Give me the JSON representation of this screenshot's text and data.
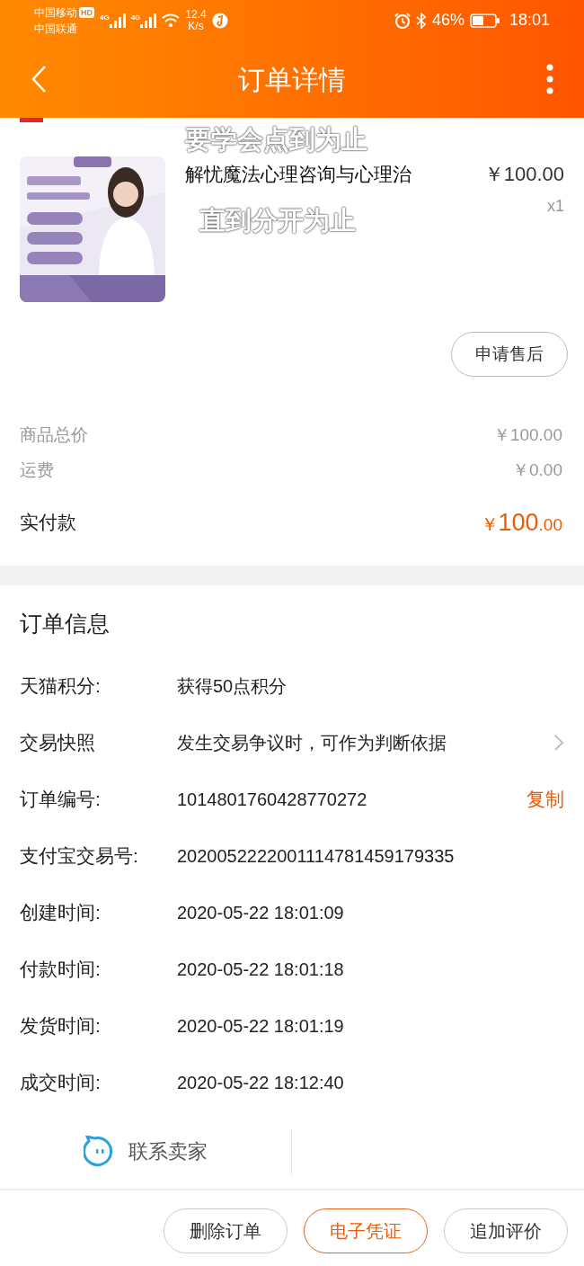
{
  "status_bar": {
    "carrier_1": "中国移动",
    "hd": "HD",
    "carrier_2": "中国联通",
    "net_1": "4G",
    "net_2": "4G",
    "speed": "12.4",
    "speed_unit": "K/s",
    "battery": "46%",
    "time": "18:01"
  },
  "header": {
    "title": "订单详情"
  },
  "product": {
    "title": "解忧魔法心理咨询与心理治",
    "price": "￥100.00",
    "quantity": "x1",
    "after_sale_button": "申请售后"
  },
  "caption": [
    "要学会点到为止",
    "直到分开为止"
  ],
  "summary": [
    {
      "label": "商品总价",
      "value": "￥100.00",
      "kind": "line"
    },
    {
      "label": "运费",
      "value": "￥0.00",
      "kind": "line"
    },
    {
      "label": "实付款",
      "currency": "￥",
      "value": "100",
      "decimals": ".00",
      "kind": "total"
    }
  ],
  "order_info": {
    "title": "订单信息",
    "rows": [
      {
        "label": "天猫积分:",
        "value": "获得50点积分"
      },
      {
        "label": "交易快照",
        "value": "发生交易争议时，可作为判断依据",
        "chevron": true
      },
      {
        "label": "订单编号:",
        "value": "1014801760428770272",
        "action": "复制"
      },
      {
        "label": "支付宝交易号:",
        "value": "2020052222001114781459179335"
      },
      {
        "label": "创建时间:",
        "value": "2020-05-22 18:01:09"
      },
      {
        "label": "付款时间:",
        "value": "2020-05-22 18:01:18"
      },
      {
        "label": "发货时间:",
        "value": "2020-05-22 18:01:19"
      },
      {
        "label": "成交时间:",
        "value": "2020-05-22 18:12:40"
      }
    ]
  },
  "contact": {
    "label": "联系卖家"
  },
  "actions": [
    {
      "label": "删除订单",
      "highlighted": false
    },
    {
      "label": "电子凭证",
      "highlighted": true
    },
    {
      "label": "追加评价",
      "highlighted": false
    }
  ]
}
